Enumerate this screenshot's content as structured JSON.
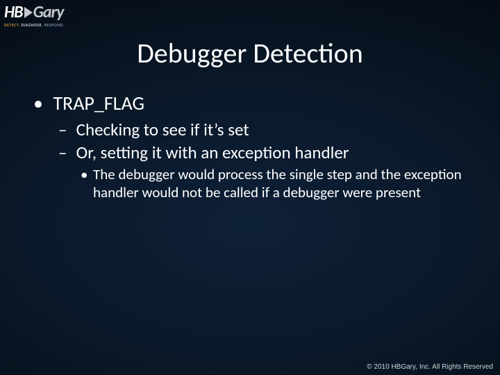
{
  "logo": {
    "hb": "HB",
    "gary": "Gary",
    "tag_detect": "DETECT.",
    "tag_diagnose": "DIAGNOSE.",
    "tag_respond": "RESPOND."
  },
  "title": "Debugger Detection",
  "bullets": {
    "l1": "TRAP_FLAG",
    "l2a": "Checking to see if it’s set",
    "l2b": "Or, setting it with an exception handler",
    "l3": "The debugger would process the single step and the exception handler would not be called if a debugger were present"
  },
  "footer": "© 2010 HBGary, Inc. All Rights Reserved"
}
